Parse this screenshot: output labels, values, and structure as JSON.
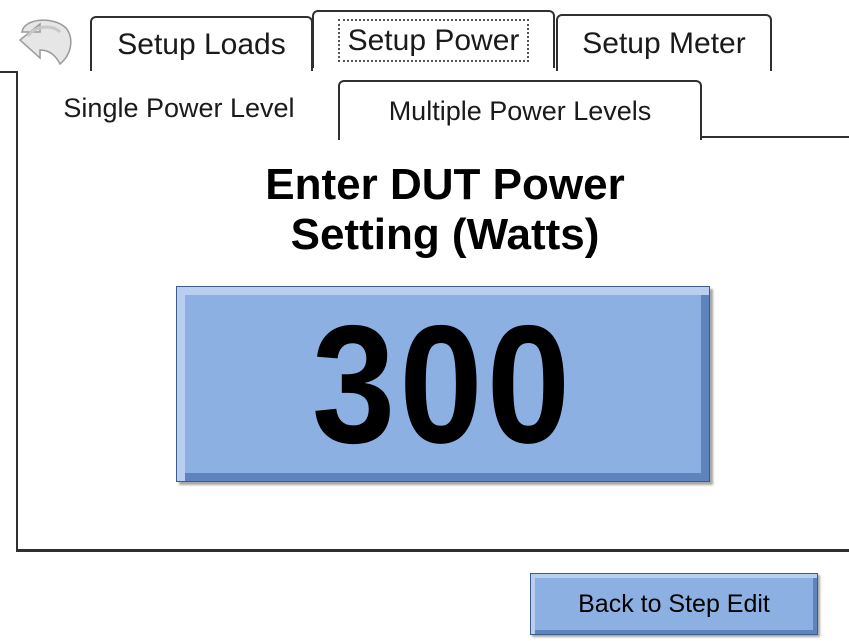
{
  "tabs": [
    {
      "label": "Setup Loads"
    },
    {
      "label": "Setup Power"
    },
    {
      "label": "Setup Meter"
    }
  ],
  "subtabs": [
    {
      "label": "Single Power Level"
    },
    {
      "label": "Multiple Power Levels"
    }
  ],
  "main": {
    "prompt_line1": "Enter DUT Power",
    "prompt_line2": "Setting (Watts)",
    "power_value": "300"
  },
  "footer": {
    "back_label": "Back to Step Edit"
  },
  "colors": {
    "button_fill": "#8db0e3",
    "border": "#303030"
  },
  "icons": {
    "back": "back-arrow-icon"
  }
}
